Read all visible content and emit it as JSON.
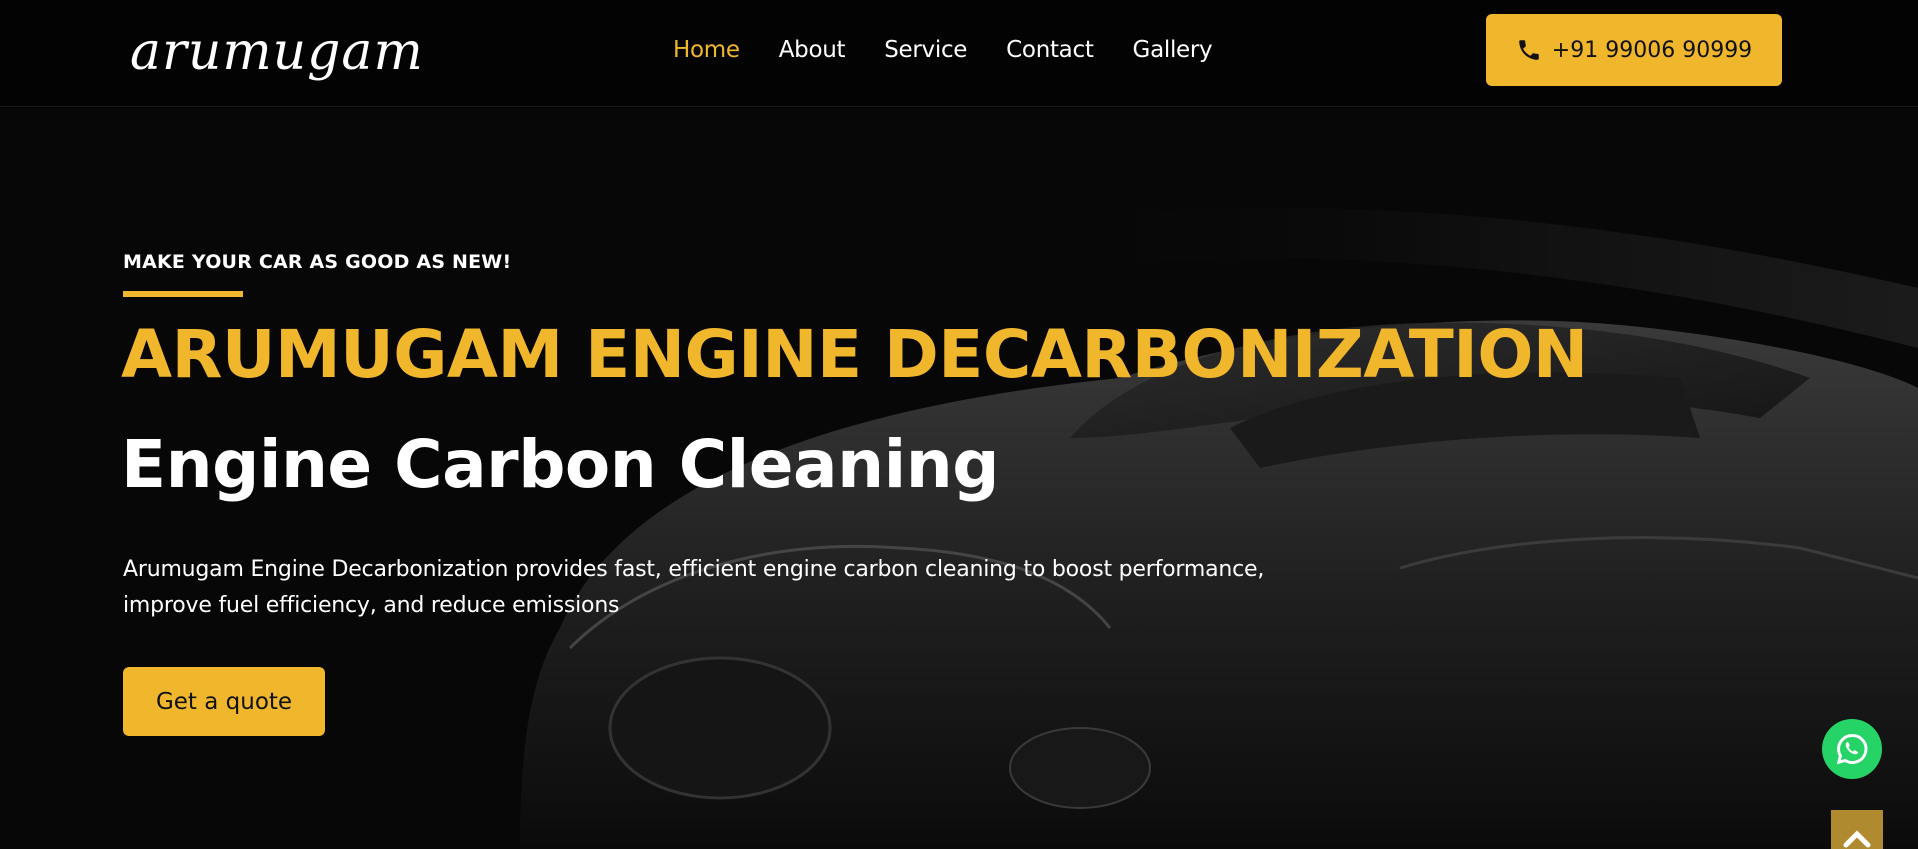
{
  "brand": {
    "logo_text": "arumugam"
  },
  "nav": {
    "items": [
      {
        "label": "Home",
        "active": true
      },
      {
        "label": "About",
        "active": false
      },
      {
        "label": "Service",
        "active": false
      },
      {
        "label": "Contact",
        "active": false
      },
      {
        "label": "Gallery",
        "active": false
      }
    ]
  },
  "header": {
    "phone_label": "+91 99006 90999",
    "phone_icon": "phone-icon"
  },
  "hero": {
    "eyebrow": "MAKE YOUR CAR AS GOOD AS NEW!",
    "headline": "ARUMUGAM ENGINE DECARBONIZATION",
    "subhead": "Engine Carbon Cleaning",
    "description": "Arumugam Engine Decarbonization provides fast, efficient engine carbon cleaning to boost performance, improve fuel efficiency, and reduce emissions",
    "cta_label": "Get a quote"
  },
  "floating": {
    "whatsapp_icon": "whatsapp-icon",
    "scroll_top_icon": "chevron-up-icon"
  },
  "colors": {
    "accent": "#f1b72c",
    "background": "#000000",
    "whatsapp": "#25d366"
  }
}
